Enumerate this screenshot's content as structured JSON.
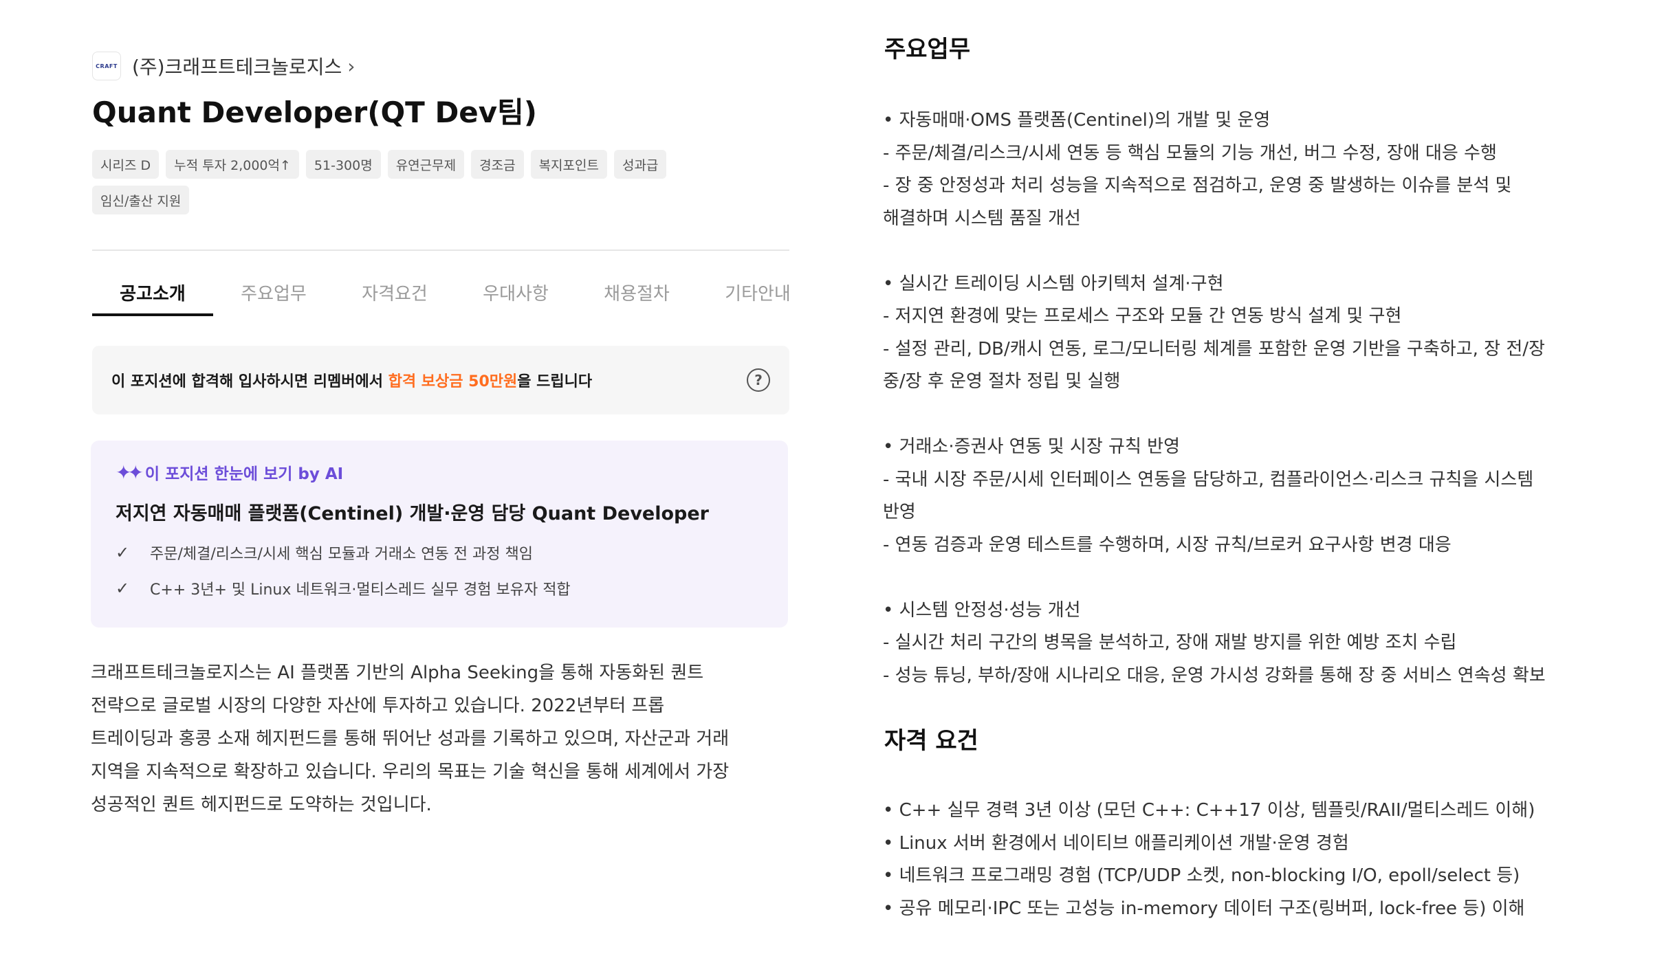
{
  "company": {
    "logo_text": "CRAFT",
    "name": "(주)크래프트테크놀로지스",
    "chevron": "›"
  },
  "job_title": "Quant Developer(QT Dev팀)",
  "tags": [
    "시리즈 D",
    "누적 투자 2,000억↑",
    "51-300명",
    "유연근무제",
    "경조금",
    "복지포인트",
    "성과급",
    "임신/출산 지원"
  ],
  "tabs": [
    "공고소개",
    "주요업무",
    "자격요건",
    "우대사항",
    "채용절차",
    "기타안내"
  ],
  "active_tab": "공고소개",
  "reward": {
    "before": "이 포지션에 합격해 입사하시면 리멤버에서 ",
    "highlight": "합격 보상금 50만원",
    "after": "을 드립니다",
    "help_icon": "?"
  },
  "ai_summary": {
    "label": "이 포지션 한눈에 보기 by AI",
    "headline": "저지연 자동매매 플랫폼(Centinel) 개발·운영 담당 Quant Developer",
    "bullets": [
      "주문/체결/리스크/시세 핵심 모듈과 거래소 연동 전 과정 책임",
      "C++ 3년+ 및 Linux 네트워크·멀티스레드 실무 경험 보유자 적합"
    ]
  },
  "about_lines": [
    "크래프트테크놀로지스는 AI 플랫폼 기반의 Alpha Seeking을 통해 자동화된 퀀트",
    "전략으로 글로벌 시장의 다양한 자산에 투자하고 있습니다. 2022년부터 프롭",
    "트레이딩과 홍콩 소재 헤지펀드를 통해 뛰어난 성과를 기록하고 있으며, 자산군과 거래",
    "지역을 지속적으로 확장하고 있습니다. 우리의 목표는 기술 혁신을 통해 세계에서 가장",
    "성공적인 퀀트 헤지펀드로 도약하는 것입니다."
  ],
  "duties": {
    "title": "주요업무",
    "lines": [
      "• 자동매매·OMS 플랫폼(Centinel)의 개발 및 운영",
      "- 주문/체결/리스크/시세 연동 등 핵심 모듈의 기능 개선, 버그 수정, 장애 대응 수행",
      "- 장 중 안정성과 처리 성능을 지속적으로 점검하고, 운영 중 발생하는 이슈를 분석 및",
      "해결하며 시스템 품질 개선",
      "",
      "• 실시간 트레이딩 시스템 아키텍처 설계·구현",
      "- 저지연 환경에 맞는 프로세스 구조와 모듈 간 연동 방식 설계 및 구현",
      "- 설정 관리, DB/캐시 연동, 로그/모니터링 체계를 포함한 운영 기반을 구축하고, 장 전/장",
      "중/장 후 운영 절차 정립 및 실행",
      "",
      "• 거래소·증권사 연동 및 시장 규칙 반영",
      "- 국내 시장 주문/시세 인터페이스 연동을 담당하고, 컴플라이언스·리스크 규칙을 시스템",
      "반영",
      "- 연동 검증과 운영 테스트를 수행하며, 시장 규칙/브로커 요구사항 변경 대응",
      "",
      "• 시스템 안정성·성능 개선",
      "- 실시간 처리 구간의 병목을 분석하고, 장애 재발 방지를 위한 예방 조치 수립",
      "- 성능 튜닝, 부하/장애 시나리오 대응, 운영 가시성 강화를 통해 장 중 서비스 연속성 확보"
    ]
  },
  "qualifications": {
    "title": "자격 요건",
    "lines": [
      "• C++ 실무 경력 3년 이상 (모던 C++: C++17 이상, 템플릿/RAII/멀티스레드 이해)",
      "• Linux 서버 환경에서 네이티브 애플리케이션 개발·운영 경험",
      "• 네트워크 프로그래밍 경험 (TCP/UDP 소켓, non-blocking I/O, epoll/select 등)",
      "• 공유 메모리·IPC 또는 고성능 in-memory 데이터 구조(링버퍼, lock-free 등) 이해"
    ]
  }
}
